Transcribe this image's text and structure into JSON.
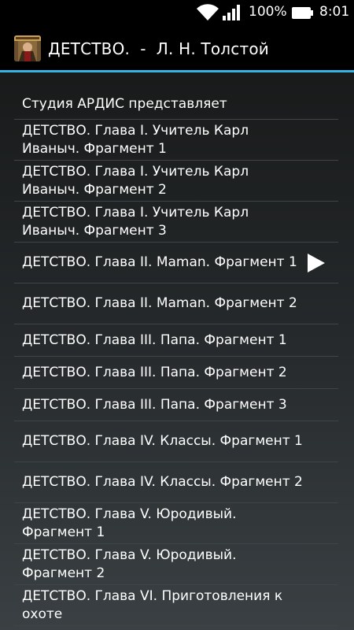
{
  "status_bar": {
    "battery_percent": "100%",
    "time": "8:01",
    "icons": [
      "wifi-icon",
      "signal-icon",
      "battery-icon"
    ]
  },
  "action_bar": {
    "title": "ДЕТСТВО.  -  Л. Н. Толстой",
    "icon": "book-cover-icon"
  },
  "colors": {
    "accent": "#33b5e5",
    "background": "#1f2223"
  },
  "playlist": {
    "items": [
      {
        "label": "Студия АРДИС представляет"
      },
      {
        "label": "ДЕТСТВО. Глава I. Учитель Карл Иваныч. Фрагмент 1"
      },
      {
        "label": "ДЕТСТВО. Глава I. Учитель Карл Иваныч. Фрагмент 2"
      },
      {
        "label": "ДЕТСТВО. Глава I. Учитель Карл Иваныч. Фрагмент 3"
      },
      {
        "label": "ДЕТСТВО. Глава II. Maman. Фрагмент 1",
        "playing": true
      },
      {
        "label": "ДЕТСТВО. Глава II. Maman. Фрагмент 2"
      },
      {
        "label": "ДЕТСТВО. Глава III. Папа. Фрагмент 1"
      },
      {
        "label": "ДЕТСТВО. Глава III. Папа. Фрагмент 2"
      },
      {
        "label": "ДЕТСТВО. Глава III. Папа. Фрагмент 3"
      },
      {
        "label": "ДЕТСТВО. Глава IV. Классы. Фрагмент 1"
      },
      {
        "label": "ДЕТСТВО. Глава IV. Классы. Фрагмент 2"
      },
      {
        "label": "ДЕТСТВО. Глава V. Юродивый. Фрагмент 1"
      },
      {
        "label": "ДЕТСТВО. Глава V. Юродивый. Фрагмент 2"
      },
      {
        "label": "ДЕТСТВО. Глава VI. Приготовления к охоте"
      }
    ]
  }
}
